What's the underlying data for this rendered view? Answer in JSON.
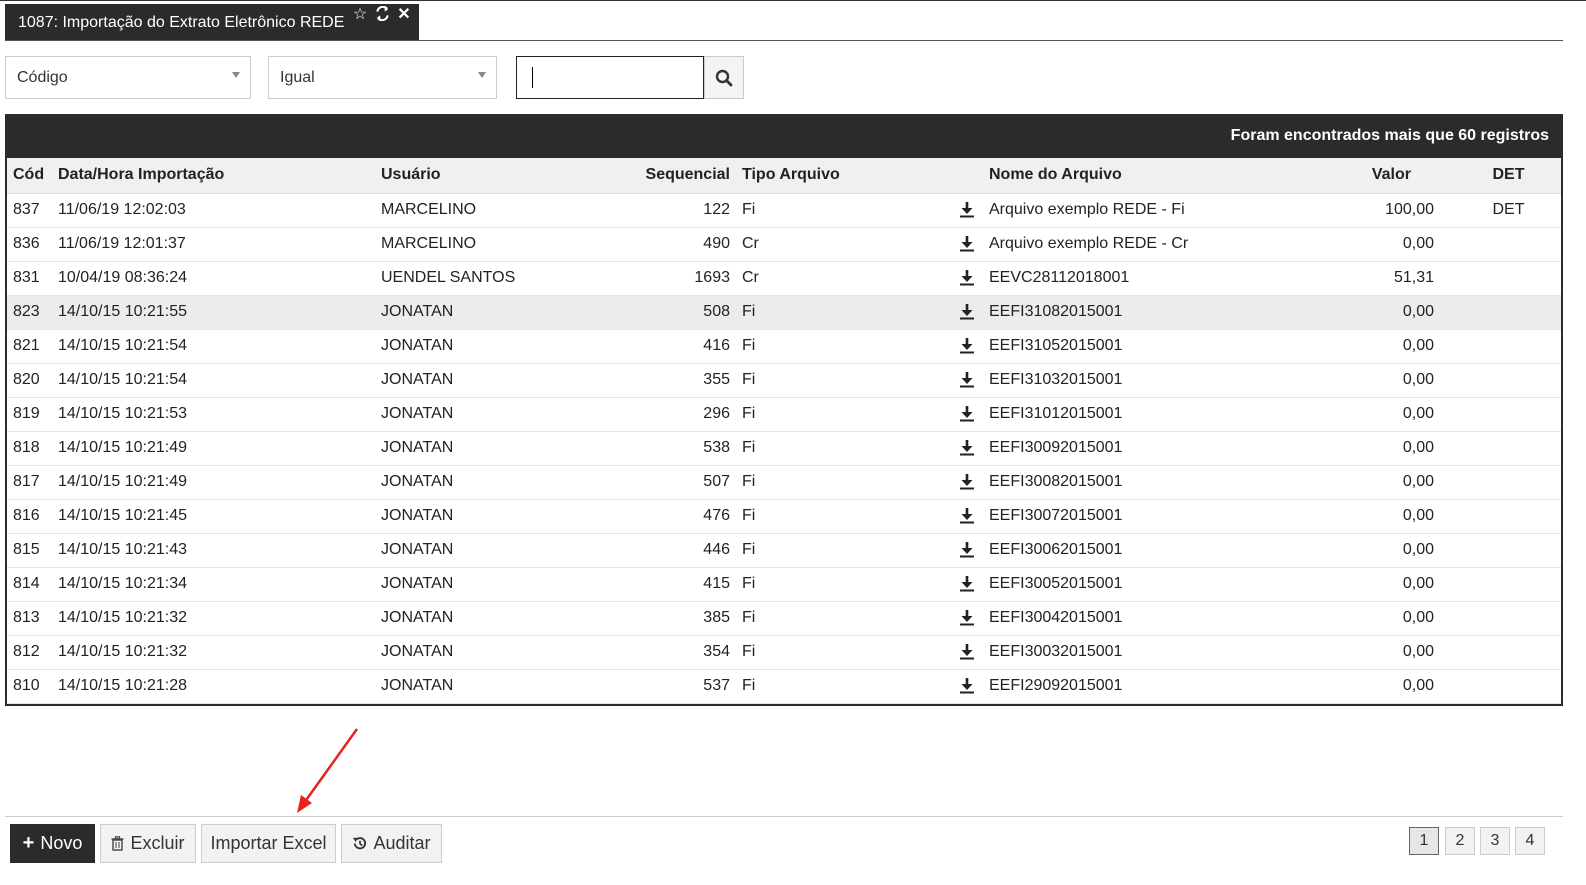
{
  "tab": {
    "title": "1087: Importação do Extrato Eletrônico REDE"
  },
  "filter": {
    "field": "Código",
    "operator": "Igual",
    "value": ""
  },
  "grid": {
    "banner": "Foram encontrados mais que 60 registros",
    "columns": [
      "Cód",
      "Data/Hora Importação",
      "Usuário",
      "Sequencial",
      "Tipo Arquivo",
      "Nome do Arquivo",
      "Valor",
      "DET"
    ],
    "rows": [
      [
        "837",
        "11/06/19 12:02:03",
        "MARCELINO",
        "122",
        "Fi",
        "Arquivo exemplo REDE - Fi",
        "100,00",
        "DET"
      ],
      [
        "836",
        "11/06/19 12:01:37",
        "MARCELINO",
        "490",
        "Cr",
        "Arquivo exemplo REDE - Cr",
        "0,00",
        ""
      ],
      [
        "831",
        "10/04/19 08:36:24",
        "UENDEL SANTOS",
        "1693",
        "Cr",
        "EEVC28112018001",
        "51,31",
        ""
      ],
      [
        "823",
        "14/10/15 10:21:55",
        "JONATAN",
        "508",
        "Fi",
        "EEFI31082015001",
        "0,00",
        ""
      ],
      [
        "821",
        "14/10/15 10:21:54",
        "JONATAN",
        "416",
        "Fi",
        "EEFI31052015001",
        "0,00",
        ""
      ],
      [
        "820",
        "14/10/15 10:21:54",
        "JONATAN",
        "355",
        "Fi",
        "EEFI31032015001",
        "0,00",
        ""
      ],
      [
        "819",
        "14/10/15 10:21:53",
        "JONATAN",
        "296",
        "Fi",
        "EEFI31012015001",
        "0,00",
        ""
      ],
      [
        "818",
        "14/10/15 10:21:49",
        "JONATAN",
        "538",
        "Fi",
        "EEFI30092015001",
        "0,00",
        ""
      ],
      [
        "817",
        "14/10/15 10:21:49",
        "JONATAN",
        "507",
        "Fi",
        "EEFI30082015001",
        "0,00",
        ""
      ],
      [
        "816",
        "14/10/15 10:21:45",
        "JONATAN",
        "476",
        "Fi",
        "EEFI30072015001",
        "0,00",
        ""
      ],
      [
        "815",
        "14/10/15 10:21:43",
        "JONATAN",
        "446",
        "Fi",
        "EEFI30062015001",
        "0,00",
        ""
      ],
      [
        "814",
        "14/10/15 10:21:34",
        "JONATAN",
        "415",
        "Fi",
        "EEFI30052015001",
        "0,00",
        ""
      ],
      [
        "813",
        "14/10/15 10:21:32",
        "JONATAN",
        "385",
        "Fi",
        "EEFI30042015001",
        "0,00",
        ""
      ],
      [
        "812",
        "14/10/15 10:21:32",
        "JONATAN",
        "354",
        "Fi",
        "EEFI30032015001",
        "0,00",
        ""
      ],
      [
        "810",
        "14/10/15 10:21:28",
        "JONATAN",
        "537",
        "Fi",
        "EEFI29092015001",
        "0,00",
        ""
      ]
    ],
    "highlighted_row": 3
  },
  "footer": {
    "buttons": {
      "novo": "Novo",
      "excluir": "Excluir",
      "importar": "Importar Excel",
      "auditar": "Auditar"
    },
    "pages": [
      "1",
      "2",
      "3",
      "4"
    ],
    "active_page": "1"
  },
  "colors": {
    "dark": "#2b2b2b",
    "annotation_arrow": "#e8231e"
  }
}
